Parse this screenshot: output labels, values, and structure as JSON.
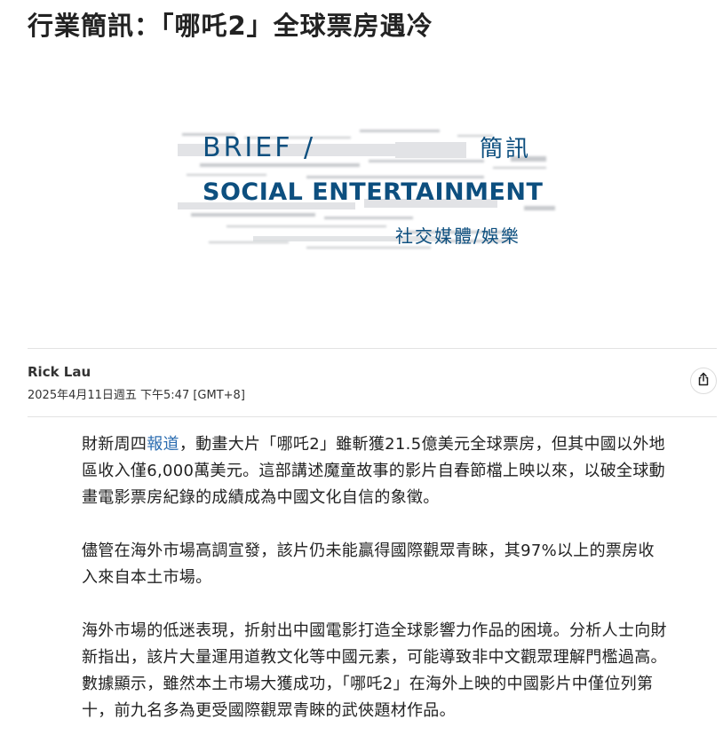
{
  "headline": "行業簡訊：「哪吒2」全球票房遇冷",
  "banner": {
    "line1": "BRIEF /",
    "line1_cjk": "簡訊",
    "line2": "SOCIAL ENTERTAINMENT",
    "line3": "社交媒體/娛樂",
    "accent_color": "#0d4f7f"
  },
  "byline": {
    "author": "Rick Lau",
    "date": "2025年4月11日週五 下午5:47 [GMT+8]"
  },
  "share": {
    "icon": "share-icon"
  },
  "article": {
    "p1_before": "財新周四",
    "p1_link": "報道",
    "p1_after": "，動畫大片「哪吒2」雖斬獲21.5億美元全球票房，但其中國以外地區收入僅6,000萬美元。這部講述魔童故事的影片自春節檔上映以來，以破全球動畫電影票房紀錄的成績成為中國文化自信的象徵。",
    "p2": "儘管在海外市場高調宣發，該片仍未能贏得國際觀眾青睞，其97%以上的票房收入來自本土市場。",
    "p3": "海外市場的低迷表現，折射出中國電影打造全球影響力作品的困境。分析人士向財新指出，該片大量運用道教文化等中國元素，可能導致非中文觀眾理解門檻過高。數據顯示，雖然本土市場大獲成功，「哪吒2」在海外上映的中國影片中僅位列第十，前九名多為更受國際觀眾青睞的武俠題材作品。"
  }
}
